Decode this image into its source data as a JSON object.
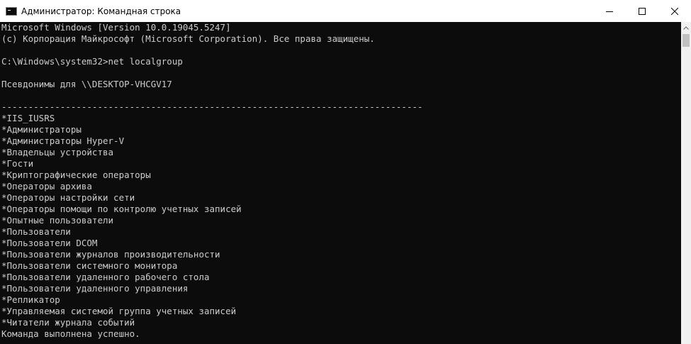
{
  "window": {
    "title": "Администратор: Командная строка"
  },
  "console": {
    "lines": [
      "Microsoft Windows [Version 10.0.19045.5247]",
      "(с) Корпорация Майкрософт (Microsoft Corporation). Все права защищены.",
      "",
      "C:\\Windows\\system32>net localgroup",
      "",
      "Псевдонимы для \\\\DESKTOP-VHCGV17",
      "",
      "-------------------------------------------------------------------------------",
      "*IIS_IUSRS",
      "*Администраторы",
      "*Администраторы Hyper-V",
      "*Владельцы устройства",
      "*Гости",
      "*Криптографические операторы",
      "*Операторы архива",
      "*Операторы настройки сети",
      "*Операторы помощи по контролю учетных записей",
      "*Опытные пользователи",
      "*Пользователи",
      "*Пользователи DCOM",
      "*Пользователи журналов производительности",
      "*Пользователи системного монитора",
      "*Пользователи удаленного рабочего стола",
      "*Пользователи удаленного управления",
      "*Репликатор",
      "*Управляемая системой группа учетных записей",
      "*Читатели журнала событий",
      "Команда выполнена успешно."
    ]
  }
}
